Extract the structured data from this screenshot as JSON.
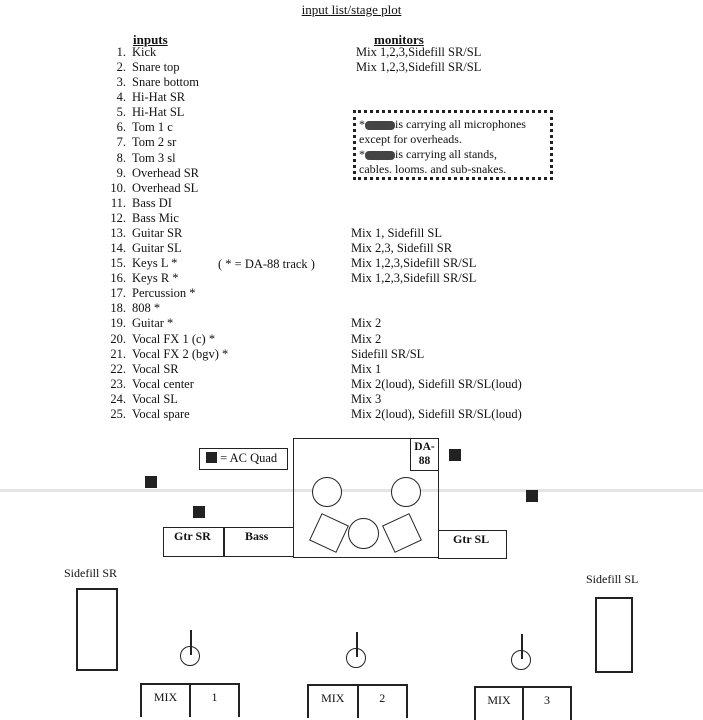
{
  "title": "input list/stage plot",
  "inputs_header": "inputs",
  "monitors_header": "monitors",
  "inputs": [
    {
      "n": "1.",
      "name": "Kick",
      "monitor": "Mix 1,2,3,Sidefill SR/SL"
    },
    {
      "n": "2.",
      "name": "Snare top",
      "monitor": "Mix 1,2,3,Sidefill SR/SL"
    },
    {
      "n": "3.",
      "name": "Snare bottom",
      "monitor": ""
    },
    {
      "n": "4.",
      "name": "Hi-Hat SR",
      "monitor": ""
    },
    {
      "n": "5.",
      "name": "Hi-Hat SL",
      "monitor": ""
    },
    {
      "n": "6.",
      "name": "Tom 1 c",
      "monitor": ""
    },
    {
      "n": "7.",
      "name": "Tom 2 sr",
      "monitor": ""
    },
    {
      "n": "8.",
      "name": "Tom 3 sl",
      "monitor": ""
    },
    {
      "n": "9.",
      "name": "Overhead SR",
      "monitor": ""
    },
    {
      "n": "10.",
      "name": "Overhead SL",
      "monitor": ""
    },
    {
      "n": "11.",
      "name": "Bass DI",
      "monitor": ""
    },
    {
      "n": "12.",
      "name": "Bass Mic",
      "monitor": ""
    },
    {
      "n": "13.",
      "name": "Guitar SR",
      "monitor": "Mix 1, Sidefill SL"
    },
    {
      "n": "14.",
      "name": "Guitar SL",
      "monitor": "Mix 2,3, Sidefill SR"
    },
    {
      "n": "15.",
      "name": "Keys L *",
      "monitor": "Mix 1,2,3,Sidefill SR/SL"
    },
    {
      "n": "16.",
      "name": "Keys R *",
      "monitor": "Mix 1,2,3,Sidefill SR/SL"
    },
    {
      "n": "17.",
      "name": "Percussion *",
      "monitor": ""
    },
    {
      "n": "18.",
      "name": "808 *",
      "monitor": ""
    },
    {
      "n": "19.",
      "name": "Guitar *",
      "monitor": "Mix 2"
    },
    {
      "n": "20.",
      "name": "Vocal FX 1 (c) *",
      "monitor": "Mix 2"
    },
    {
      "n": "21.",
      "name": "Vocal FX 2 (bgv) *",
      "monitor": "Sidefill SR/SL"
    },
    {
      "n": "22.",
      "name": "Vocal SR",
      "monitor": "Mix 1"
    },
    {
      "n": "23.",
      "name": "Vocal center",
      "monitor": "Mix 2(loud), Sidefill SR/SL(loud)"
    },
    {
      "n": "24.",
      "name": "Vocal SL",
      "monitor": "Mix 3"
    },
    {
      "n": "25.",
      "name": "Vocal spare",
      "monitor": "Mix 2(loud), Sidefill SR/SL(loud)"
    }
  ],
  "da88_note": "( * = DA-88 track )",
  "note": {
    "line1": "is carrying all microphones",
    "line2": "except for overheads.",
    "line3": "is carrying all stands,",
    "line4": "cables. looms. and sub-snakes."
  },
  "stage": {
    "ac_quad_legend": "= AC Quad",
    "da88": "DA-",
    "da88_2": "88",
    "gtr_sr": "Gtr SR",
    "bass": "Bass",
    "gtr_sl": "Gtr SL",
    "sidefill_sr": "Sidefill SR",
    "sidefill_sl": "Sidefill SL",
    "mix_label": "MIX",
    "mixes": [
      "1",
      "2",
      "3"
    ]
  }
}
